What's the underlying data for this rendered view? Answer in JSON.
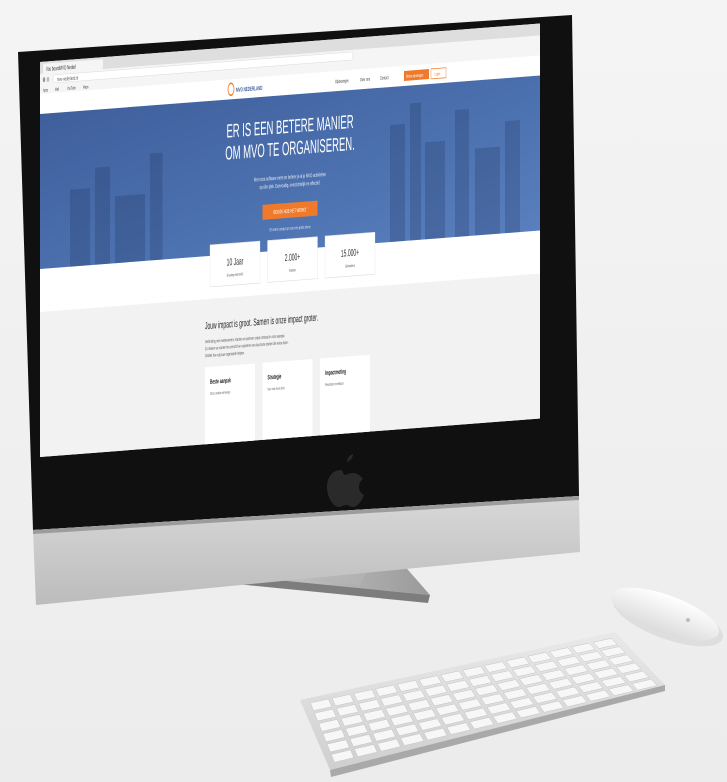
{
  "browser": {
    "tab_title": "Vos boardMVO Nederl",
    "address": "mvo-nederland.nl",
    "bookmarks": [
      "Apps",
      "Mail",
      "YouTube",
      "Maps"
    ]
  },
  "site": {
    "logo_text": "MVO NEDERLAND",
    "nav": [
      "Oplossingen",
      "Over ons",
      "Contact"
    ],
    "nav_cta_primary": "Demo aanvragen",
    "nav_cta_secondary": "Login"
  },
  "hero": {
    "headline_line1": "ER IS EEN BETERE MANIER",
    "headline_line2": "OM MVO TE ORGANISEREN.",
    "subtext_line1": "Met onze software meet en beheer je al je MVO activiteiten",
    "subtext_line2": "op één plek. Eenvoudig, overzichtelijk en effectief.",
    "cta": "BEKIJK HOE HET WERKT",
    "cta_note": "Of neem contact op voor een gratis demo"
  },
  "stats": [
    {
      "value": "10 Jaar",
      "label": "Ervaring met MVO"
    },
    {
      "value": "2.000+",
      "label": "Klanten"
    },
    {
      "value": "15.000+",
      "label": "Gebruikers"
    }
  ],
  "impact": {
    "heading": "Jouw impact is groot. Samen is onze impact groter.",
    "body_line1": "Verbinding met medewerkers, klanten en partners staat centraal in onze aanpak.",
    "body_line2": "Zo maken we samen het verschil en realiseren we duurzame doelen die ertoe doen.",
    "body_line3": "Ontdek hoe wij jouw organisatie helpen."
  },
  "cards": [
    {
      "title": "Beste aanpak",
      "text": "Onze unieke werkwijze"
    },
    {
      "title": "Strategie",
      "text": "Van visie naar actie"
    },
    {
      "title": "Impactmeting",
      "text": "Resultaten meetbaar"
    }
  ],
  "colors": {
    "hero_blue": "#4a6fae",
    "cta_orange": "#f07a2c",
    "bezel": "#141414",
    "chin": "#c9c9c9",
    "stand": "#a5a5a5"
  }
}
